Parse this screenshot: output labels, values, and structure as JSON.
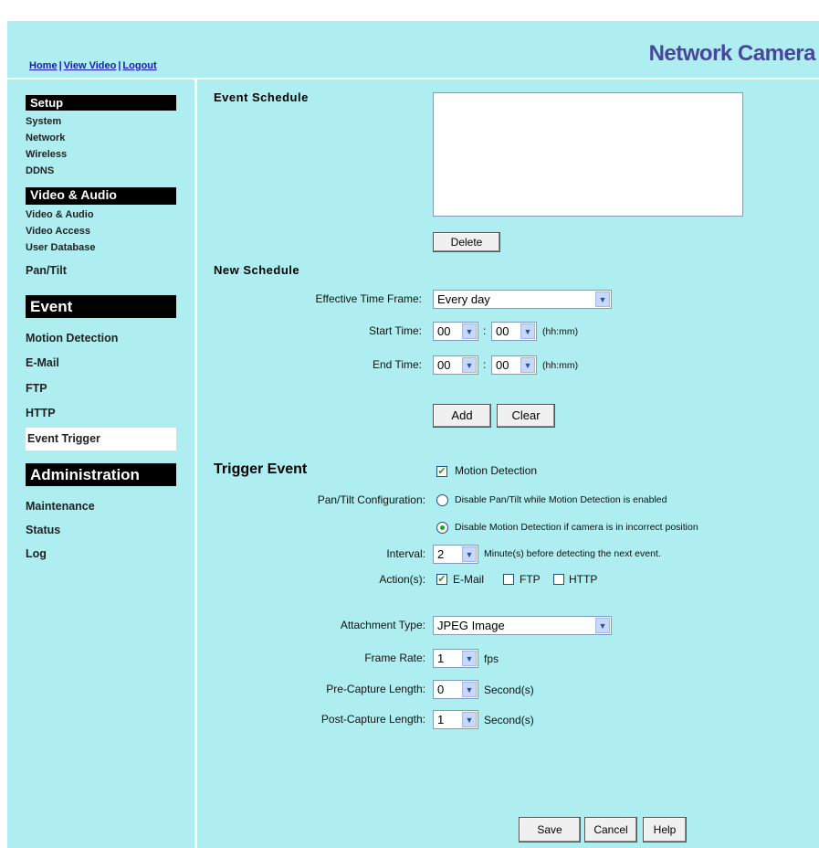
{
  "header": {
    "links": [
      "Home",
      "View Video",
      "Logout"
    ],
    "brand": "Network Camera"
  },
  "sidebar": {
    "setup_title": "Setup",
    "setup_items": [
      "System",
      "Network",
      "Wireless",
      "DDNS"
    ],
    "va_title": "Video & Audio",
    "va_items": [
      "Video & Audio",
      "Video Access",
      "User Database"
    ],
    "pantilt": "Pan/Tilt",
    "event_title": "Event",
    "event_items": [
      "Motion Detection",
      "E-Mail",
      "FTP",
      "HTTP",
      "Event Trigger"
    ],
    "admin_title": "Administration",
    "admin_items": [
      "Maintenance",
      "Status",
      "Log"
    ]
  },
  "schedule": {
    "title": "Event Schedule",
    "delete": "Delete",
    "new_title": "New Schedule",
    "frame_label": "Effective Time Frame:",
    "frame_value": "Every day",
    "start_label": "Start Time:",
    "end_label": "End Time:",
    "start_h": "00",
    "start_m": "00",
    "end_h": "00",
    "end_m": "00",
    "colon": ":",
    "unit": "(hh:mm)",
    "add": "Add",
    "clear": "Clear"
  },
  "trigger": {
    "title": "Trigger Event",
    "motion_label": "Motion Detection",
    "motion_checked": true,
    "pantilt_label": "Pan/Tilt Configuration:",
    "radio1": "Disable Pan/Tilt while Motion Detection is enabled",
    "radio2": "Disable Motion Detection if camera is in incorrect position",
    "radio_selected": 2,
    "interval_label": "Interval:",
    "interval_value": "2",
    "interval_text": "Minute(s) before detecting the next event.",
    "action_label": "Action(s):",
    "email": "E-Mail",
    "email_checked": true,
    "ftp": "FTP",
    "ftp_checked": false,
    "http": "HTTP",
    "http_checked": false,
    "attach_label": "Attachment Type:",
    "attach_value": "JPEG Image",
    "frame_rate_label": "Frame Rate:",
    "frame_rate_value": "1",
    "fps": "fps",
    "pre_label": "Pre-Capture Length:",
    "pre_value": "0",
    "post_label": "Post-Capture Length:",
    "post_value": "1",
    "seconds": "Second(s)"
  },
  "footer": {
    "save": "Save",
    "cancel": "Cancel",
    "help": "Help"
  }
}
